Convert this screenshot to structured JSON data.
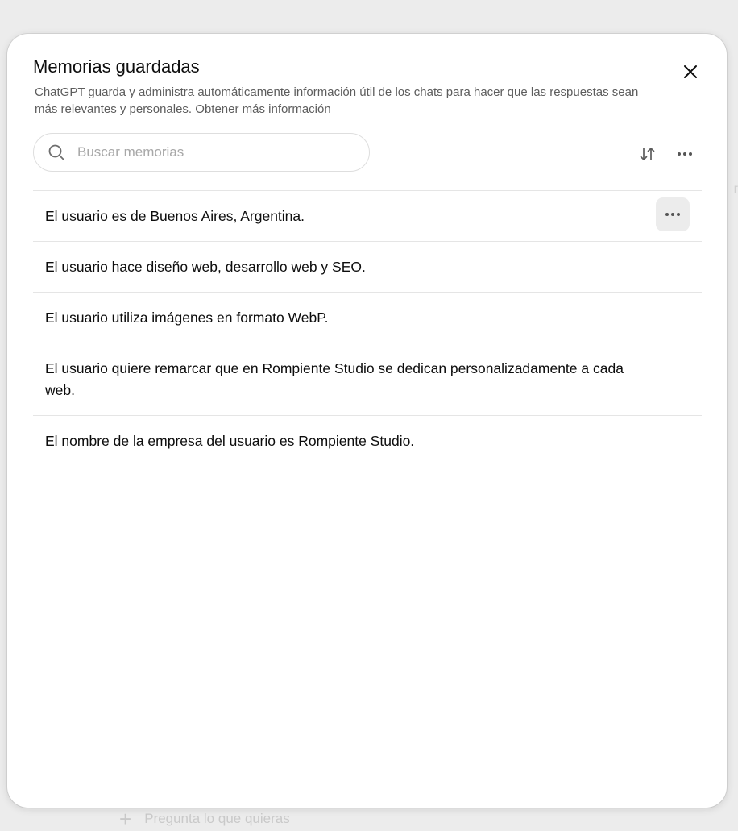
{
  "modal": {
    "title": "Memorias guardadas",
    "description": "ChatGPT guarda y administra automáticamente información útil de los chats para hacer que las respuestas sean más relevantes y personales.",
    "learn_more_link": "Obtener más información"
  },
  "search": {
    "placeholder": "Buscar memorias",
    "value": ""
  },
  "icons": {
    "close": "close-icon",
    "search": "search-icon",
    "sort": "sort-icon",
    "more": "more-horizontal-icon"
  },
  "memories": [
    {
      "text": "El usuario es de Buenos Aires, Argentina.",
      "hovered": true
    },
    {
      "text": "El usuario hace diseño web, desarrollo web y SEO."
    },
    {
      "text": "El usuario utiliza imágenes en formato WebP."
    },
    {
      "text": "El usuario quiere remarcar que en Rompiente Studio se dedican personalizadamente a cada web."
    },
    {
      "text": "El nombre de la empresa del usuario es Rompiente Studio."
    }
  ],
  "background": {
    "composer_placeholder": "Pregunta lo que quieras",
    "add_symbol": "+"
  },
  "colors": {
    "backdrop": "#ececec",
    "modal_bg": "#ffffff",
    "divider": "#e5e5e5",
    "text": "#0d0d0d",
    "muted_text": "#5d5d5d"
  }
}
